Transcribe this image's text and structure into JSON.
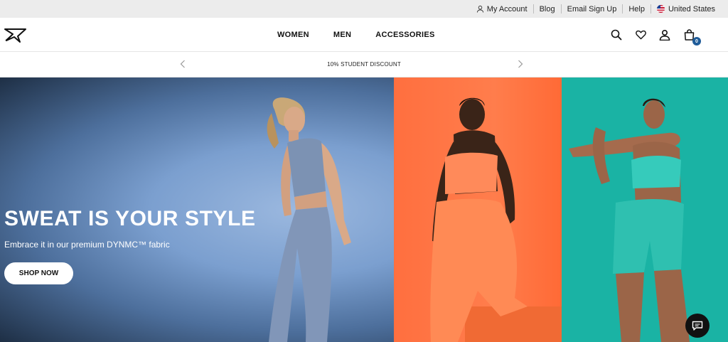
{
  "utility": {
    "my_account": "My Account",
    "blog": "Blog",
    "email_signup": "Email Sign Up",
    "help": "Help",
    "region": "United States"
  },
  "header": {
    "logo_icon": "gymshark-shark-logo",
    "nav": {
      "women": "WOMEN",
      "men": "MEN",
      "accessories": "ACCESSORIES"
    },
    "bag_count": "0"
  },
  "promo": {
    "text": "10% STUDENT DISCOUNT"
  },
  "hero": {
    "title": "SWEAT IS YOUR STYLE",
    "subtitle": "Embrace it in our premium DYNMC™ fabric",
    "cta": "SHOP NOW"
  },
  "colors": {
    "panel_blue": "#7b9fcf",
    "panel_orange": "#ff7a4a",
    "panel_teal": "#1ab3a4",
    "badge_blue": "#1f5c99"
  }
}
